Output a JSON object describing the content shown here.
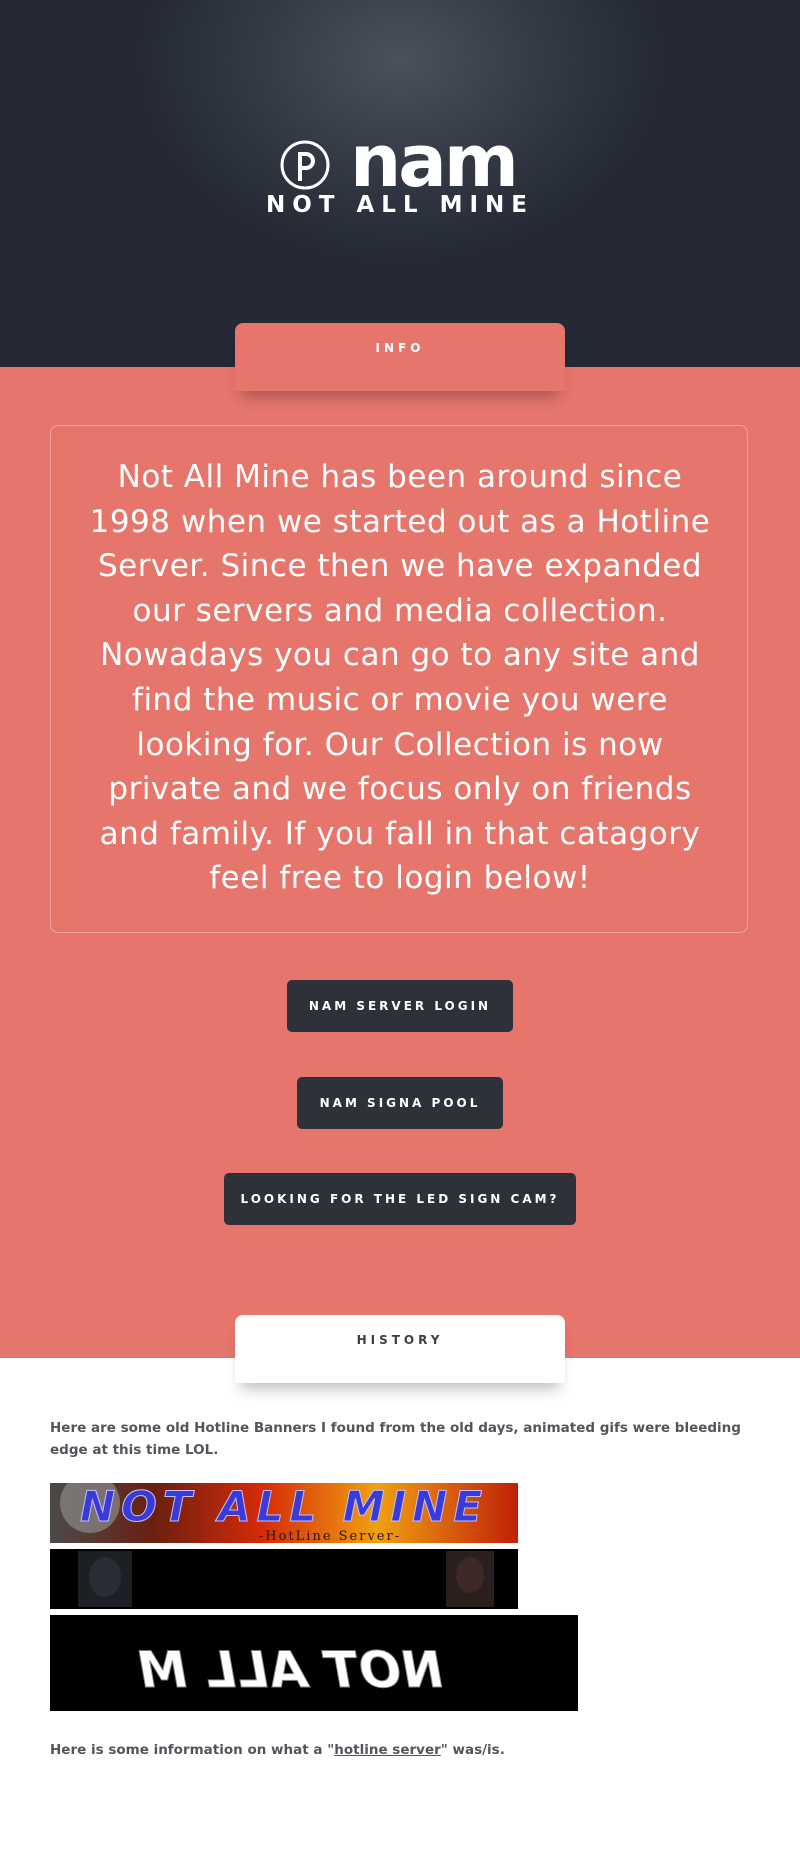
{
  "logo": {
    "wordmark": "nam",
    "tagline": "NOT ALL MINE",
    "emblem_icon": "pirate-p-icon"
  },
  "colors": {
    "header_bg": "#2b303c",
    "accent_red": "#e6756c",
    "button_bg": "#2e313a",
    "text_dark": "#52555c"
  },
  "tabs": {
    "info": "INFO",
    "history": "HISTORY"
  },
  "info": {
    "text": "Not All Mine has been around since 1998 when we started out as a Hotline Server. Since then we have expanded our servers and media collection. Nowadays you can go to any site and find the music or movie you were looking for. Our Collection is now private and we focus only on friends and family. If you fall in that catagory feel free to login below!"
  },
  "buttons": {
    "server_login": "NAM SERVER LOGIN",
    "signa_pool": "NAM SIGNA POOL",
    "led_sign_cam": "LOOKING FOR THE LED SIGN CAM?"
  },
  "history": {
    "intro": "Here are some old Hotline Banners I found from the old days, animated gifs were bleeding edge at this time LOL.",
    "banners": [
      {
        "title": "NOT ALL MINE",
        "subtitle": "-HotLine Server-"
      },
      {
        "title": ""
      },
      {
        "title": "NOT ALL M"
      }
    ],
    "info_prefix": "Here is some information on what a \"",
    "info_link": "hotline server",
    "info_suffix": "\" was/is."
  }
}
